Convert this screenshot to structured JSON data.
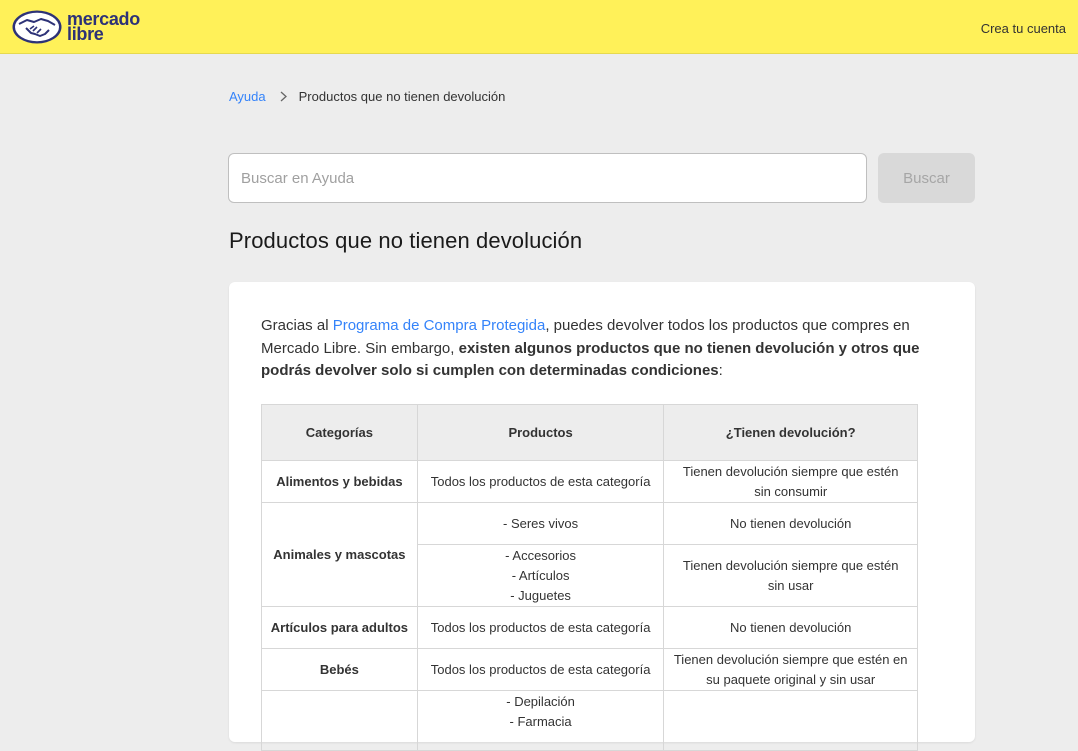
{
  "header": {
    "logo_line1": "mercado",
    "logo_line2": "libre",
    "create_account": "Crea tu cuenta",
    "brand_yellow": "#fff159",
    "logo_text_color": "#2d3277"
  },
  "breadcrumb": {
    "home": "Ayuda",
    "current": "Productos que no tienen devolución"
  },
  "search": {
    "placeholder": "Buscar en Ayuda",
    "button": "Buscar"
  },
  "page": {
    "title": "Productos que no tienen devolución"
  },
  "intro": {
    "text_before_link": "Gracias al ",
    "link": "Programa de Compra Protegida",
    "text_after_link": ", puedes devolver todos los productos que compres en Mercado Libre. Sin embargo, ",
    "bold": "existen algunos productos que no tienen devolución y otros que podrás devolver solo si cumplen con determinadas condiciones",
    "end": ":"
  },
  "table": {
    "headers": [
      "Categorías",
      "Productos",
      "¿Tienen devolución?"
    ],
    "rows": [
      {
        "category": "Alimentos y bebidas",
        "products": "Todos los productos de esta categoría",
        "returnable": [
          "Tienen devolución siempre que estén",
          "sin consumir"
        ]
      },
      {
        "category": "Animales y mascotas",
        "products": "- Seres vivos",
        "returnable": [
          "No tienen devolución"
        ]
      },
      {
        "products": [
          "- Accesorios",
          "- Artículos",
          "- Juguetes"
        ],
        "returnable": [
          "Tienen devolución siempre que estén",
          "sin usar"
        ]
      },
      {
        "category": "Artículos para adultos",
        "products": "Todos los productos de esta categoría",
        "returnable": [
          "No tienen devolución"
        ]
      },
      {
        "category": "Bebés",
        "products": "Todos los productos de esta categoría",
        "returnable": [
          "Tienen devolución siempre que estén en",
          "su paquete original y sin usar"
        ]
      },
      {
        "products": [
          "- Depilación",
          "- Farmacia"
        ],
        "returnable": [
          ""
        ]
      }
    ]
  },
  "colors": {
    "link_blue": "#3483fa",
    "page_bg": "#ededed"
  }
}
